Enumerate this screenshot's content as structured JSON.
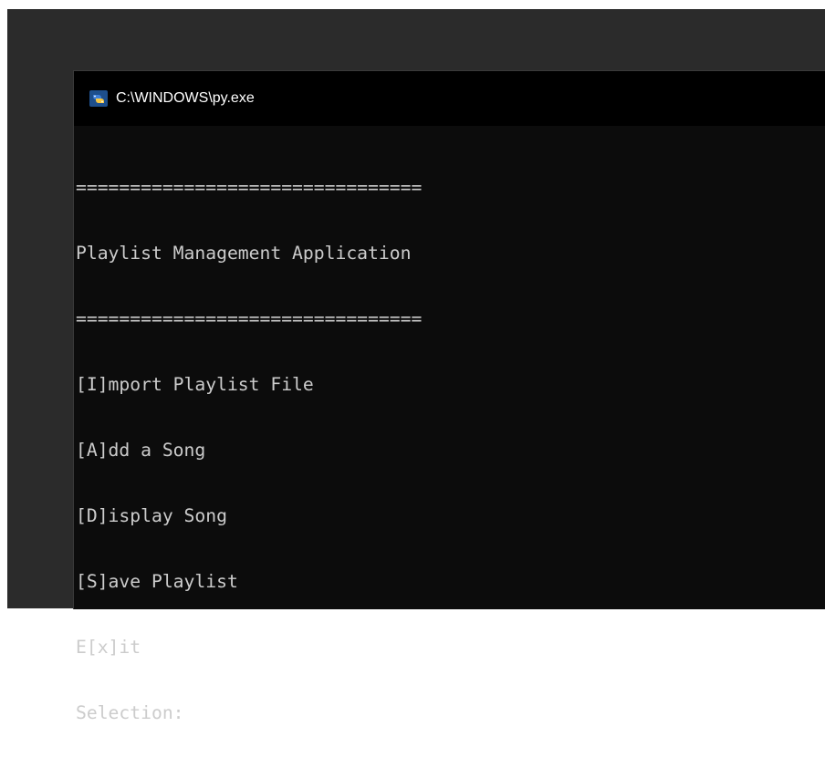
{
  "window": {
    "title": "C:\\WINDOWS\\py.exe",
    "icon": "python-icon"
  },
  "console": {
    "lines": [
      "================================",
      "Playlist Management Application",
      "================================",
      "[I]mport Playlist File",
      "[A]dd a Song",
      "[D]isplay Song",
      "[S]ave Playlist",
      "E[x]it",
      "Selection:"
    ]
  },
  "colors": {
    "console_background": "#0c0c0c",
    "console_text": "#cccccc",
    "title_bar": "#000000",
    "title_text": "#ffffff",
    "desktop": "#2b2b2b"
  }
}
